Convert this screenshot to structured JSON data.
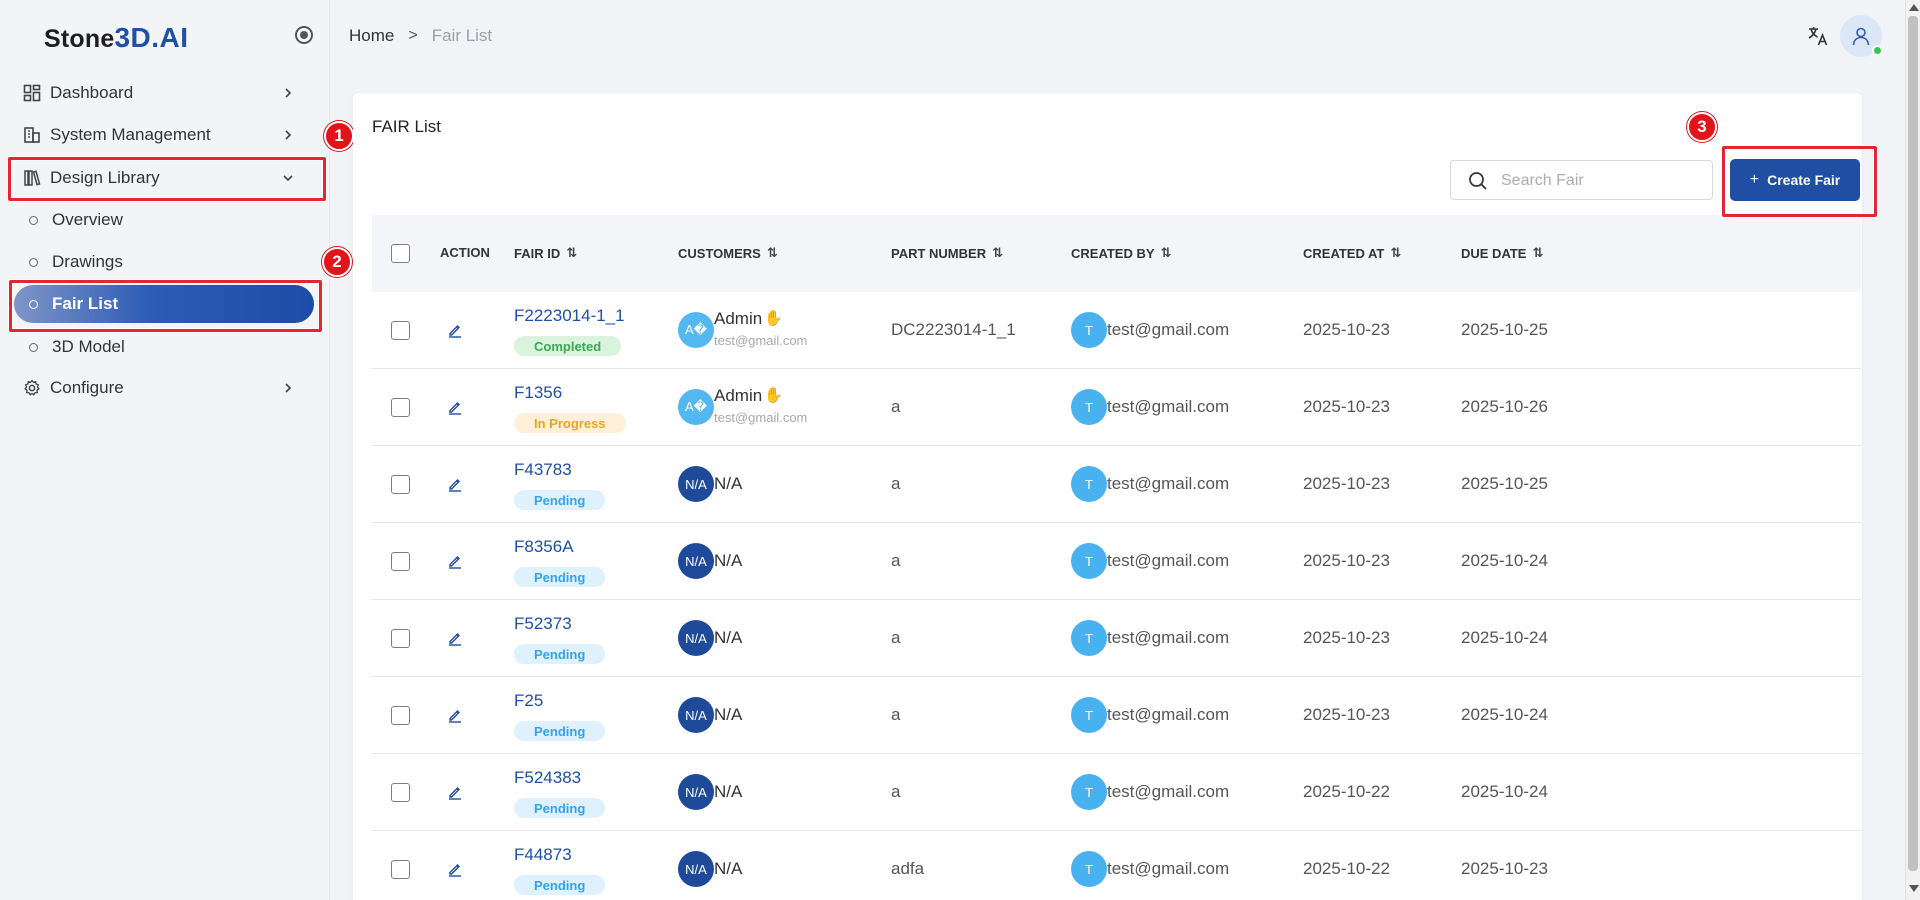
{
  "app": {
    "logo_prefix": "Stone",
    "logo_accent": "3D.AI"
  },
  "sidebar": {
    "items": [
      {
        "label": "Dashboard",
        "icon": "dashboard-icon"
      },
      {
        "label": "System Management",
        "icon": "building-icon"
      },
      {
        "label": "Design Library",
        "icon": "library-icon",
        "expanded": true
      },
      {
        "label": "Configure",
        "icon": "gear-icon"
      }
    ],
    "sub_items": [
      {
        "label": "Overview"
      },
      {
        "label": "Drawings"
      },
      {
        "label": "Fair List",
        "active": true
      },
      {
        "label": "3D Model"
      }
    ]
  },
  "annotations": {
    "markers": [
      "1",
      "2",
      "3"
    ],
    "highlight_color": "#e3262f"
  },
  "breadcrumb": {
    "home": "Home",
    "separator": ">",
    "current": "Fair List"
  },
  "main": {
    "title": "FAIR List",
    "search_placeholder": "Search Fair",
    "create_button": "Create Fair",
    "create_button_icon": "+"
  },
  "table": {
    "headers": {
      "action": "ACTION",
      "fair_id": "FAIR ID",
      "customers": "CUSTOMERS",
      "part_number": "PART NUMBER",
      "created_by": "CREATED BY",
      "created_at": "CREATED AT",
      "due_date": "DUE DATE"
    },
    "sort_icon": "⇅",
    "rows": [
      {
        "fair_id": "F2223014-1_1",
        "status": "Completed",
        "customer_avatar": "A�",
        "customer_name": "Admin",
        "customer_email": "test@gmail.com",
        "part_number": "DC2223014-1_1",
        "creator_initial": "T",
        "creator": "test@gmail.com",
        "created_at": "2025-10-23",
        "due_date": "2025-10-25"
      },
      {
        "fair_id": "F1356",
        "status": "In Progress",
        "customer_avatar": "A�",
        "customer_name": "Admin",
        "customer_email": "test@gmail.com",
        "part_number": "a",
        "creator_initial": "T",
        "creator": "test@gmail.com",
        "created_at": "2025-10-23",
        "due_date": "2025-10-26"
      },
      {
        "fair_id": "F43783",
        "status": "Pending",
        "customer_avatar": "N/A",
        "customer_name": "N/A",
        "customer_email": "",
        "part_number": "a",
        "creator_initial": "T",
        "creator": "test@gmail.com",
        "created_at": "2025-10-23",
        "due_date": "2025-10-25"
      },
      {
        "fair_id": "F8356A",
        "status": "Pending",
        "customer_avatar": "N/A",
        "customer_name": "N/A",
        "customer_email": "",
        "part_number": "a",
        "creator_initial": "T",
        "creator": "test@gmail.com",
        "created_at": "2025-10-23",
        "due_date": "2025-10-24"
      },
      {
        "fair_id": "F52373",
        "status": "Pending",
        "customer_avatar": "N/A",
        "customer_name": "N/A",
        "customer_email": "",
        "part_number": "a",
        "creator_initial": "T",
        "creator": "test@gmail.com",
        "created_at": "2025-10-23",
        "due_date": "2025-10-24"
      },
      {
        "fair_id": "F25",
        "status": "Pending",
        "customer_avatar": "N/A",
        "customer_name": "N/A",
        "customer_email": "",
        "part_number": "a",
        "creator_initial": "T",
        "creator": "test@gmail.com",
        "created_at": "2025-10-23",
        "due_date": "2025-10-24"
      },
      {
        "fair_id": "F524383",
        "status": "Pending",
        "customer_avatar": "N/A",
        "customer_name": "N/A",
        "customer_email": "",
        "part_number": "a",
        "creator_initial": "T",
        "creator": "test@gmail.com",
        "created_at": "2025-10-22",
        "due_date": "2025-10-24"
      },
      {
        "fair_id": "F44873",
        "status": "Pending",
        "customer_avatar": "N/A",
        "customer_name": "N/A",
        "customer_email": "",
        "part_number": "adfa",
        "creator_initial": "T",
        "creator": "test@gmail.com",
        "created_at": "2025-10-22",
        "due_date": "2025-10-23"
      }
    ]
  },
  "colors": {
    "brand": "#1f4ea3",
    "status_completed": "#3ba852",
    "status_in_progress": "#e7a52b",
    "status_pending": "#34a3ea"
  }
}
